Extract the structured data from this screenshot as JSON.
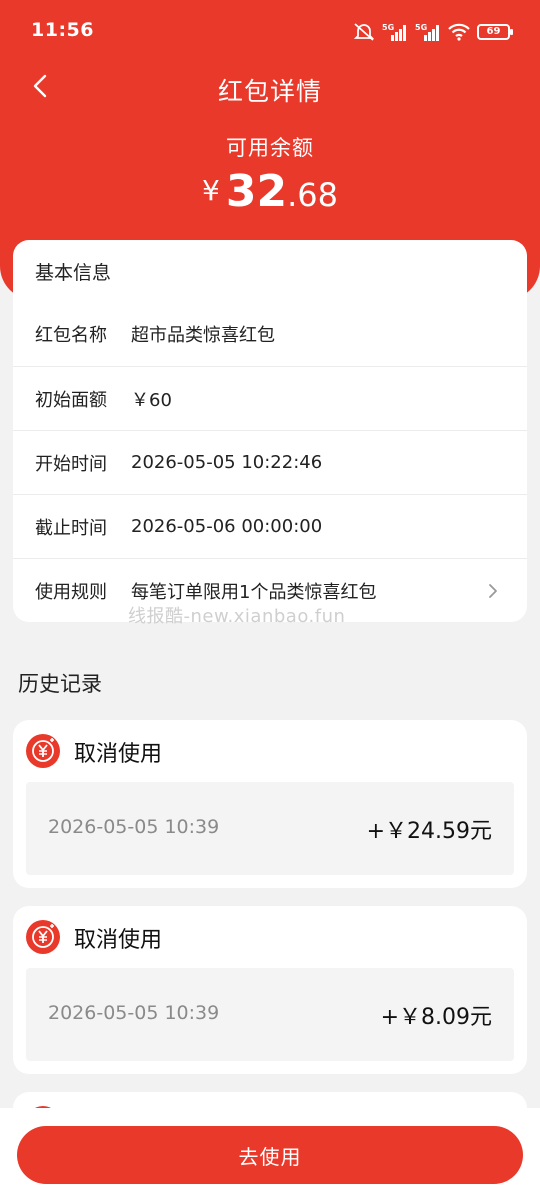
{
  "status_bar": {
    "time": "11:56",
    "battery": "69",
    "signal_1": "5G",
    "signal_2": "5G"
  },
  "nav": {
    "title": "红包详情"
  },
  "balance": {
    "label": "可用余额",
    "currency": "¥",
    "integer": "32",
    "decimal": ".68"
  },
  "info": {
    "title": "基本信息",
    "rows": [
      {
        "label": "红包名称",
        "value": "超市品类惊喜红包"
      },
      {
        "label": "初始面额",
        "value": "￥60"
      },
      {
        "label": "开始时间",
        "value": "2026-05-05 10:22:46"
      },
      {
        "label": "截止时间",
        "value": "2026-05-06 00:00:00"
      },
      {
        "label": "使用规则",
        "value": "每笔订单限用1个品类惊喜红包"
      }
    ]
  },
  "watermark": "线报酷-new.xianbao.fun",
  "history": {
    "title": "历史记录",
    "items": [
      {
        "title": "取消使用",
        "time": "2026-05-05 10:39",
        "amount": "+￥24.59元"
      },
      {
        "title": "取消使用",
        "time": "2026-05-05 10:39",
        "amount": "+￥8.09元"
      }
    ]
  },
  "bottom": {
    "use_button": "去使用"
  },
  "colors": {
    "brand_red": "#e8392b",
    "background": "#f2f2f2"
  }
}
